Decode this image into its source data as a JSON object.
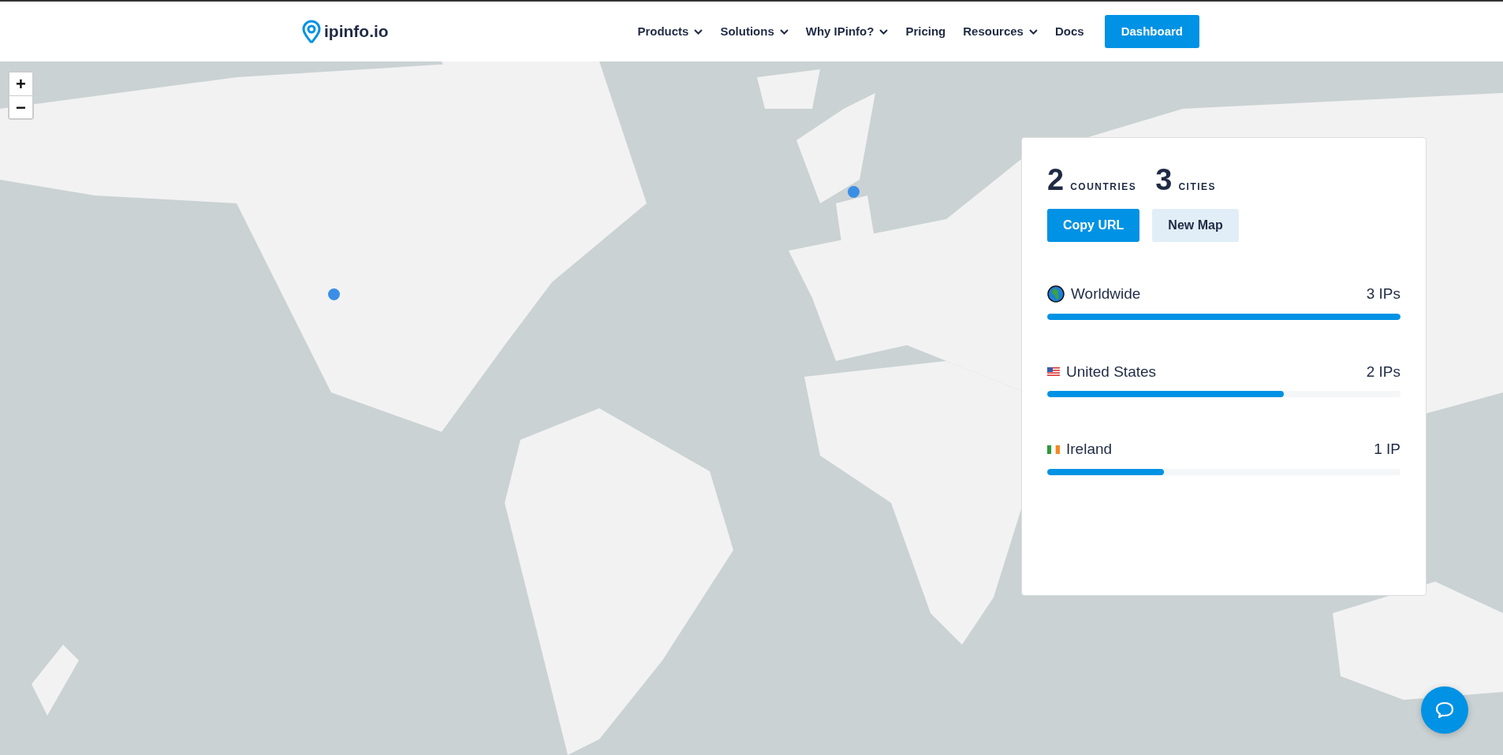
{
  "header": {
    "logo": "ipinfo.io",
    "nav": [
      {
        "label": "Products",
        "dropdown": true
      },
      {
        "label": "Solutions",
        "dropdown": true
      },
      {
        "label": "Why IPinfo?",
        "dropdown": true
      },
      {
        "label": "Pricing",
        "dropdown": false
      },
      {
        "label": "Resources",
        "dropdown": true
      },
      {
        "label": "Docs",
        "dropdown": false
      }
    ],
    "cta": "Dashboard"
  },
  "map": {
    "kind": "picture",
    "zoom_in": "+",
    "zoom_out": "−",
    "markers": [
      {
        "kind": "pin"
      },
      {
        "kind": "pin"
      }
    ]
  },
  "summary": {
    "stats": [
      {
        "value": "2",
        "label": "COUNTRIES"
      },
      {
        "value": "3",
        "label": "CITIES"
      }
    ],
    "buttons": [
      {
        "label": "Copy URL",
        "primary": true
      },
      {
        "label": "New Map",
        "primary": false
      }
    ],
    "rows": [
      {
        "kind": "globe",
        "name": "Worldwide",
        "count": "3 IPs",
        "level": 1.0
      },
      {
        "kind": "usflag",
        "name": "United States",
        "count": "2 IPs",
        "level": 0.67
      },
      {
        "kind": "ieflag",
        "name": "Ireland",
        "count": "1 IP",
        "level": 0.33
      }
    ]
  }
}
